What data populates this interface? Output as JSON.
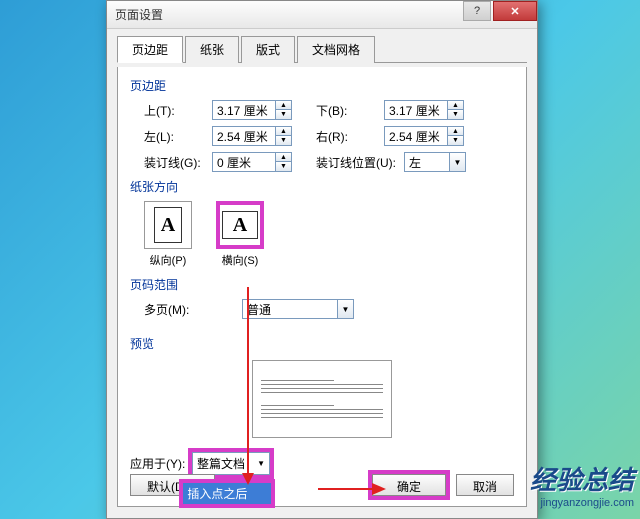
{
  "dialog": {
    "title": "页面设置",
    "tabs": [
      "页边距",
      "纸张",
      "版式",
      "文档网格"
    ],
    "margins": {
      "group": "页边距",
      "top_label": "上(T):",
      "top_value": "3.17 厘米",
      "bottom_label": "下(B):",
      "bottom_value": "3.17 厘米",
      "left_label": "左(L):",
      "left_value": "2.54 厘米",
      "right_label": "右(R):",
      "right_value": "2.54 厘米",
      "gutter_label": "装订线(G):",
      "gutter_value": "0 厘米",
      "gutter_pos_label": "装订线位置(U):",
      "gutter_pos_value": "左"
    },
    "orientation": {
      "group": "纸张方向",
      "portrait": "纵向(P)",
      "landscape": "横向(S)"
    },
    "pages": {
      "group": "页码范围",
      "multi_label": "多页(M):",
      "multi_value": "普通"
    },
    "preview": {
      "group": "预览"
    },
    "apply": {
      "label": "应用于(Y):",
      "selected": "整篇文档",
      "opt_after": "插入点之后"
    },
    "buttons": {
      "default": "默认(D)...",
      "ok": "确定",
      "cancel": "取消"
    }
  },
  "watermark": {
    "main": "经验总结",
    "sub": "jingyanzongjie.com"
  }
}
